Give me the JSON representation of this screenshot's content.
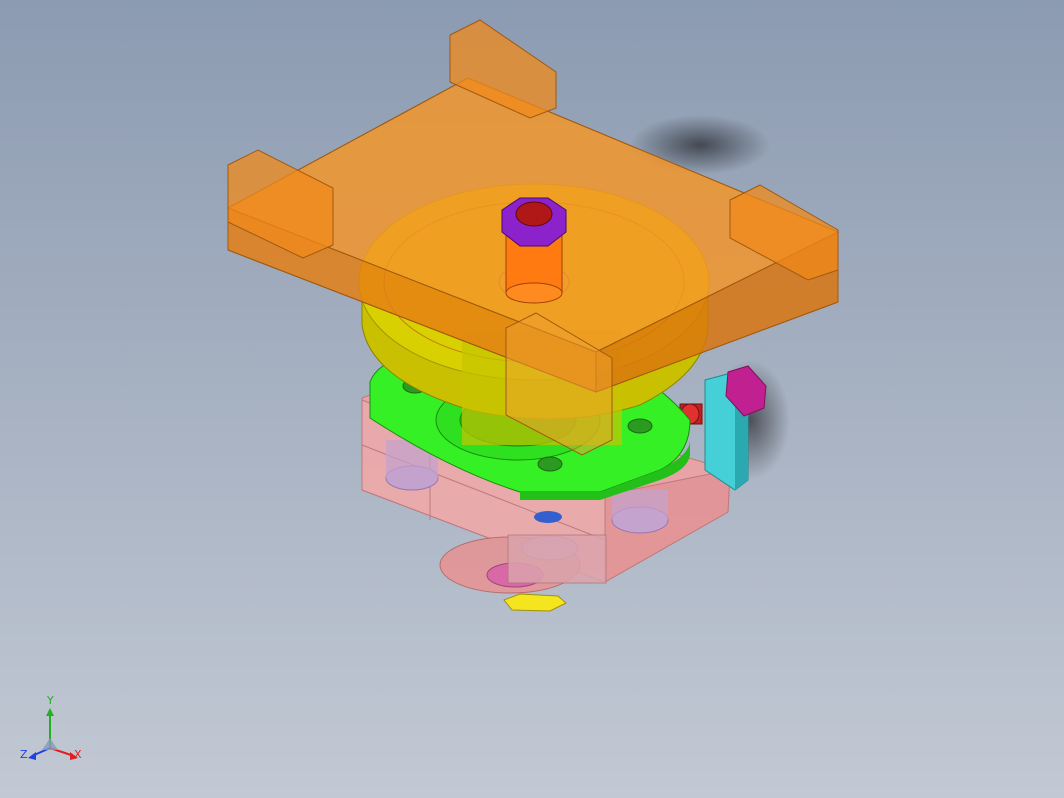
{
  "viewport": {
    "background_top": "#8c9bb2",
    "background_bottom": "#c2c9d4"
  },
  "model": {
    "parts": [
      {
        "name": "base-block",
        "color": "#f08c8c"
      },
      {
        "name": "flange",
        "color": "#33ee22"
      },
      {
        "name": "wheel",
        "color": "#d4c800"
      },
      {
        "name": "tray",
        "color": "#f08a1a"
      },
      {
        "name": "hex-nut",
        "color": "#8b22cc"
      },
      {
        "name": "side-bracket",
        "color": "#3ec6cc"
      },
      {
        "name": "side-bolt",
        "color": "#b4187a"
      },
      {
        "name": "bottom-nut",
        "color": "#f0e020"
      }
    ]
  },
  "triad": {
    "x_label": "X",
    "y_label": "Y",
    "z_label": "Z",
    "x_color": "#e02020",
    "y_color": "#20b020",
    "z_color": "#2040e0"
  }
}
